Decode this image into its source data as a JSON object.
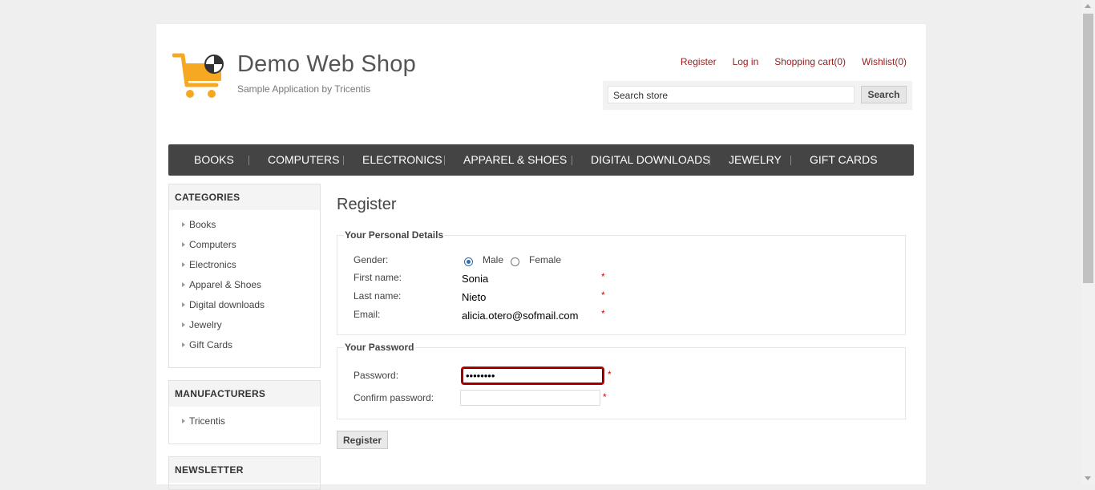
{
  "header": {
    "title": "Demo Web Shop",
    "subtitle": "Sample Application by Tricentis",
    "links": [
      "Register",
      "Log in",
      "Shopping cart(0)",
      "Wishlist(0)"
    ],
    "search_value": "Search store",
    "search_button": "Search",
    "logo_icon": "shopping-cart-logo",
    "brand_color": "#f7a823"
  },
  "menu": [
    "BOOKS",
    "COMPUTERS",
    "ELECTRONICS",
    "APPAREL & SHOES",
    "DIGITAL DOWNLOADS",
    "JEWELRY",
    "GIFT CARDS"
  ],
  "sidebar": {
    "categories_title": "CATEGORIES",
    "categories": [
      "Books",
      "Computers",
      "Electronics",
      "Apparel & Shoes",
      "Digital downloads",
      "Jewelry",
      "Gift Cards"
    ],
    "manufacturers_title": "MANUFACTURERS",
    "manufacturers": [
      "Tricentis"
    ],
    "newsletter_title": "NEWSLETTER"
  },
  "main": {
    "title": "Register",
    "personal": {
      "legend": "Your Personal Details",
      "gender_label": "Gender:",
      "male_label": "Male",
      "female_label": "Female",
      "gender_selected": "Male",
      "first_name_label": "First name:",
      "first_name_value": "Sonia",
      "last_name_label": "Last name:",
      "last_name_value": "Nieto",
      "email_label": "Email:",
      "email_value": "alicia.otero@sofmail.com"
    },
    "password": {
      "legend": "Your Password",
      "password_label": "Password:",
      "password_value": "••••••••",
      "confirm_label": "Confirm password:",
      "confirm_value": ""
    },
    "required_marker": "*",
    "register_button": "Register"
  }
}
